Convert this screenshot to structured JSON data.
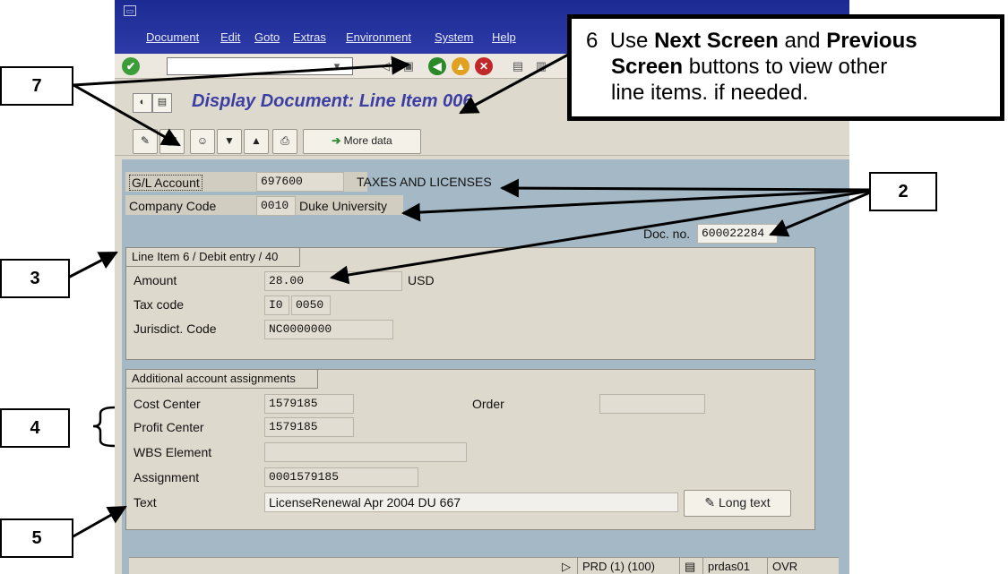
{
  "menu": [
    "Document",
    "Edit",
    "Goto",
    "Extras",
    "Environment",
    "System",
    "Help"
  ],
  "title": "Display Document: Line Item 006",
  "toolbar2": {
    "more_data": "More data"
  },
  "header": {
    "gl_label": "G/L Account",
    "gl_value": "697600",
    "gl_desc": "TAXES AND LICENSES",
    "cc_label": "Company Code",
    "cc_value": "0010",
    "cc_desc": "Duke University",
    "docno_label": "Doc. no.",
    "docno_value": "600022284"
  },
  "line_item": {
    "title": "Line Item 6 / Debit entry / 40",
    "amount_label": "Amount",
    "amount_value": "28.00",
    "currency": "USD",
    "tax_label": "Tax code",
    "tax_code": "I0",
    "tax_juris": "0050",
    "juris_label": "Jurisdict. Code",
    "juris_value": "NC0000000"
  },
  "assignments": {
    "title": "Additional account assignments",
    "cost_center_label": "Cost Center",
    "cost_center_value": "1579185",
    "order_label": "Order",
    "order_value": "",
    "profit_center_label": "Profit Center",
    "profit_center_value": "1579185",
    "wbs_label": "WBS Element",
    "wbs_value": "",
    "assignment_label": "Assignment",
    "assignment_value": "0001579185",
    "text_label": "Text",
    "text_value": "LicenseRenewal Apr 2004 DU 667",
    "long_text": "Long text"
  },
  "status": {
    "system": "PRD (1) (100)",
    "server": "prdas01",
    "mode": "OVR"
  },
  "callouts": {
    "c2": "2",
    "c3": "3",
    "c4": "4",
    "c5": "5",
    "c7": "7",
    "c6_num": "6",
    "c6_a": "Use ",
    "c6_b": "Next Screen",
    "c6_c": " and ",
    "c6_d": "Previous",
    "c6_e": "Screen",
    "c6_f": " buttons to view other",
    "c6_g": "line items. if needed."
  },
  "colors": {
    "title_bar": "#1c2b93",
    "window_bg": "#ded9cd",
    "content_bg": "#a5b8c6",
    "title_text": "#3b3fa4"
  }
}
